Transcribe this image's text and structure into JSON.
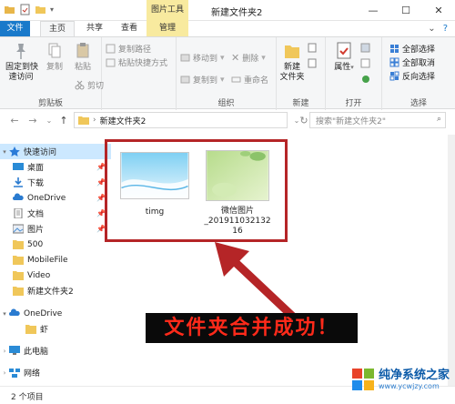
{
  "window": {
    "title": "新建文件夹2",
    "context_tab": "图片工具",
    "controls": {
      "minimize": "—",
      "maximize": "☐",
      "close": "✕"
    }
  },
  "tabs": {
    "file": "文件",
    "home": "主页",
    "share": "共享",
    "view": "查看",
    "manage": "管理"
  },
  "ribbon": {
    "clipboard": {
      "label": "剪贴板",
      "pin": "固定到快\n速访问",
      "copy": "复制",
      "paste": "粘贴",
      "copy_path": "复制路径",
      "paste_shortcut": "粘贴快捷方式",
      "cut": "剪切"
    },
    "organize": {
      "label": "组织",
      "move_to": "移动到",
      "copy_to": "复制到",
      "delete": "删除",
      "rename": "重命名"
    },
    "new": {
      "label": "新建",
      "new_folder": "新建\n文件夹"
    },
    "open": {
      "label": "打开",
      "properties": "属性"
    },
    "select": {
      "label": "选择",
      "select_all": "全部选择",
      "select_none": "全部取消",
      "invert": "反向选择"
    }
  },
  "address": {
    "path": "新建文件夹2",
    "search_placeholder": "搜索\"新建文件夹2\""
  },
  "nav": {
    "quick_access": "快速访问",
    "desktop": "桌面",
    "downloads": "下载",
    "onedrive1": "OneDrive",
    "documents": "文档",
    "pictures": "图片",
    "f500": "500",
    "mobilefile": "MobileFile",
    "video": "Video",
    "newfolder2": "新建文件夹2",
    "onedrive2": "OneDrive",
    "shrimp": "虾",
    "this_pc": "此电脑",
    "network": "网络"
  },
  "files": {
    "timg": "timg",
    "wechat": "微信图片\n_201911032132\n16"
  },
  "caption": "文件夹合并成功！",
  "status": "2 个项目",
  "watermark": {
    "line1": "纯净系统之家",
    "line2": "www.ycwjzy.com"
  },
  "colors": {
    "accent": "#1979ca",
    "context_tab": "#f8ea9f",
    "annotation_red": "#b52527",
    "caption_text": "#ff2a1a"
  }
}
